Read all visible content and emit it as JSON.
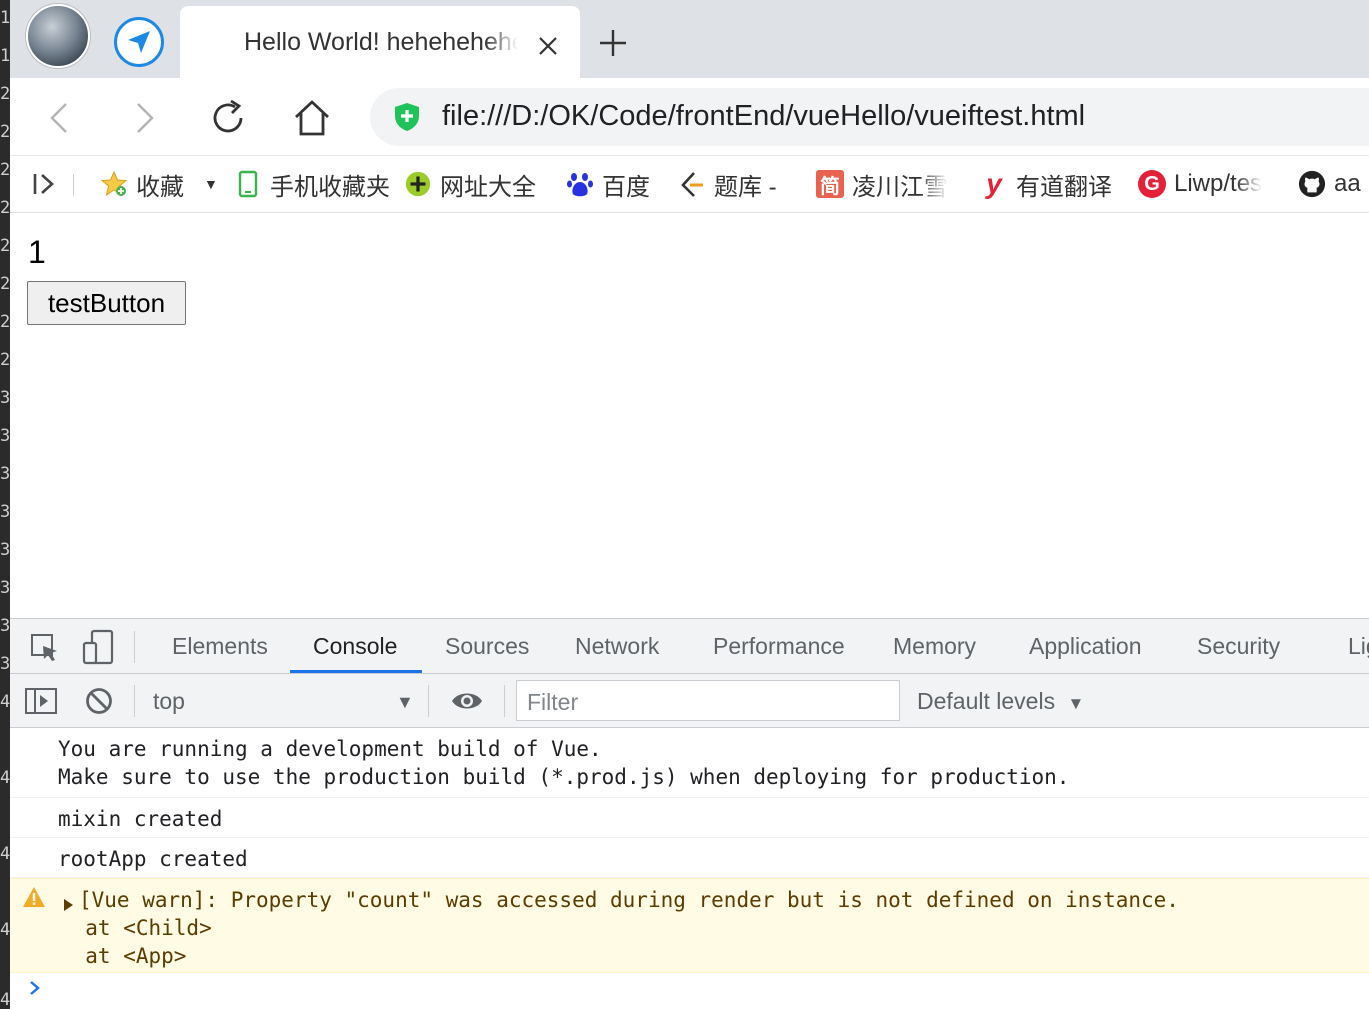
{
  "gutter": {
    "numbers": [
      "1",
      "1",
      "2",
      "2",
      "2",
      "2",
      "2",
      "2",
      "2",
      "2",
      "3",
      "3",
      "3",
      "3",
      "3",
      "3",
      "3",
      "3",
      "4",
      "4",
      "4",
      "4",
      "4"
    ]
  },
  "browser": {
    "tab_title": "Hello World! hehehehehe",
    "url": "file:///D:/OK/Code/frontEnd/vueHello/vueiftest.html",
    "icons": {
      "avatar": "profile-avatar",
      "send": "send-arrow-icon",
      "close": "close-icon",
      "new_tab": "plus-icon",
      "back": "chevron-left-icon",
      "forward": "chevron-right-icon",
      "reload": "reload-icon",
      "home": "home-icon",
      "secure": "shield-icon"
    }
  },
  "bookmarks": {
    "items": [
      {
        "label": "收藏",
        "icon": "star-icon"
      },
      {
        "label": "手机收藏夹",
        "icon": "phone-icon"
      },
      {
        "label": "网址大全",
        "icon": "plus-circle-icon"
      },
      {
        "label": "百度",
        "icon": "baidu-paw-icon"
      },
      {
        "label": "题库 -",
        "icon": "tiku-icon"
      },
      {
        "label": "凌川江雪",
        "icon": "jian-icon",
        "icon_text": "简"
      },
      {
        "label": "有道翻译",
        "icon": "youdao-icon",
        "icon_text": "y"
      },
      {
        "label": "Liwp/tes",
        "icon": "g-icon",
        "icon_text": "G"
      },
      {
        "label": "aa",
        "icon": "github-icon"
      }
    ]
  },
  "page": {
    "count": "1",
    "button_label": "testButton"
  },
  "devtools": {
    "tabs": [
      "Elements",
      "Console",
      "Sources",
      "Network",
      "Performance",
      "Memory",
      "Application",
      "Security",
      "Lig"
    ],
    "active_tab": "Console",
    "context": "top",
    "filter_placeholder": "Filter",
    "levels_label": "Default levels",
    "levels_arrow": "▼",
    "context_arrow": "▼",
    "logs": [
      {
        "lines": [
          "You are running a development build of Vue.",
          "Make sure to use the production build (*.prod.js) when deploying for production."
        ]
      },
      {
        "lines": [
          "mixin created"
        ]
      },
      {
        "lines": [
          "rootApp created"
        ]
      },
      {
        "level": "warning",
        "lines": [
          "[Vue warn]: Property \"count\" was accessed during render but is not defined on instance.",
          "  at <Child>",
          "  at <App>"
        ]
      }
    ],
    "colors": {
      "accent": "#1a73e8",
      "warning_bg": "#fffbe5",
      "warning_icon": "#f2ab26"
    }
  }
}
